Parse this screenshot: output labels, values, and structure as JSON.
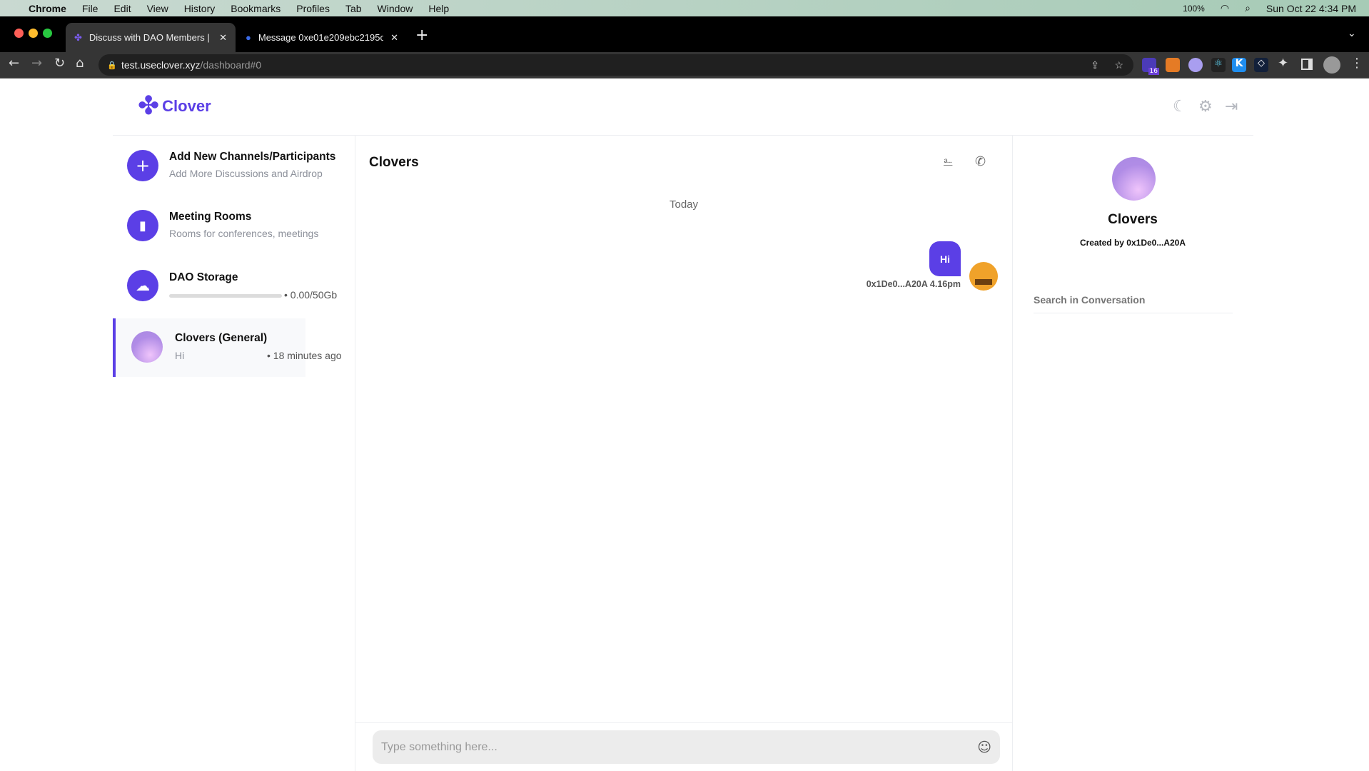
{
  "menubar": {
    "app": "Chrome",
    "items": [
      "File",
      "Edit",
      "View",
      "History",
      "Bookmarks",
      "Profiles",
      "Tab",
      "Window",
      "Help"
    ],
    "battery": "100%",
    "datetime": "Sun Oct 22  4:34 PM"
  },
  "tabs": [
    {
      "label": "Discuss with DAO Members | C"
    },
    {
      "label": "Message 0xe01e209ebc2195c"
    }
  ],
  "url": {
    "host": "test.useclover.xyz",
    "path": "/dashboard#0"
  },
  "extension_badge": "16",
  "brand": {
    "name": "Clover",
    "color": "#5b3fe6"
  },
  "sidebar": {
    "add": {
      "title": "Add New Channels/Participants",
      "subtitle": "Add More Discussions and Airdrop"
    },
    "meeting": {
      "title": "Meeting Rooms",
      "subtitle": "Rooms for conferences, meetings"
    },
    "storage": {
      "title": "DAO Storage",
      "usage": "• 0.00/50Gb",
      "fill": 0
    },
    "channels": [
      {
        "name": "Clovers (General)",
        "last": "Hi",
        "time": "• 18 minutes ago"
      }
    ]
  },
  "chat": {
    "title": "Clovers",
    "day": "Today",
    "messages": [
      {
        "text": "Hi",
        "sender": "0x1De0...A20A",
        "time": "4.16pm"
      }
    ],
    "input_placeholder": "Type something here..."
  },
  "details": {
    "name": "Clovers",
    "created_by": "Created by 0x1De0...A20A",
    "search_placeholder": "Search in Conversation"
  }
}
